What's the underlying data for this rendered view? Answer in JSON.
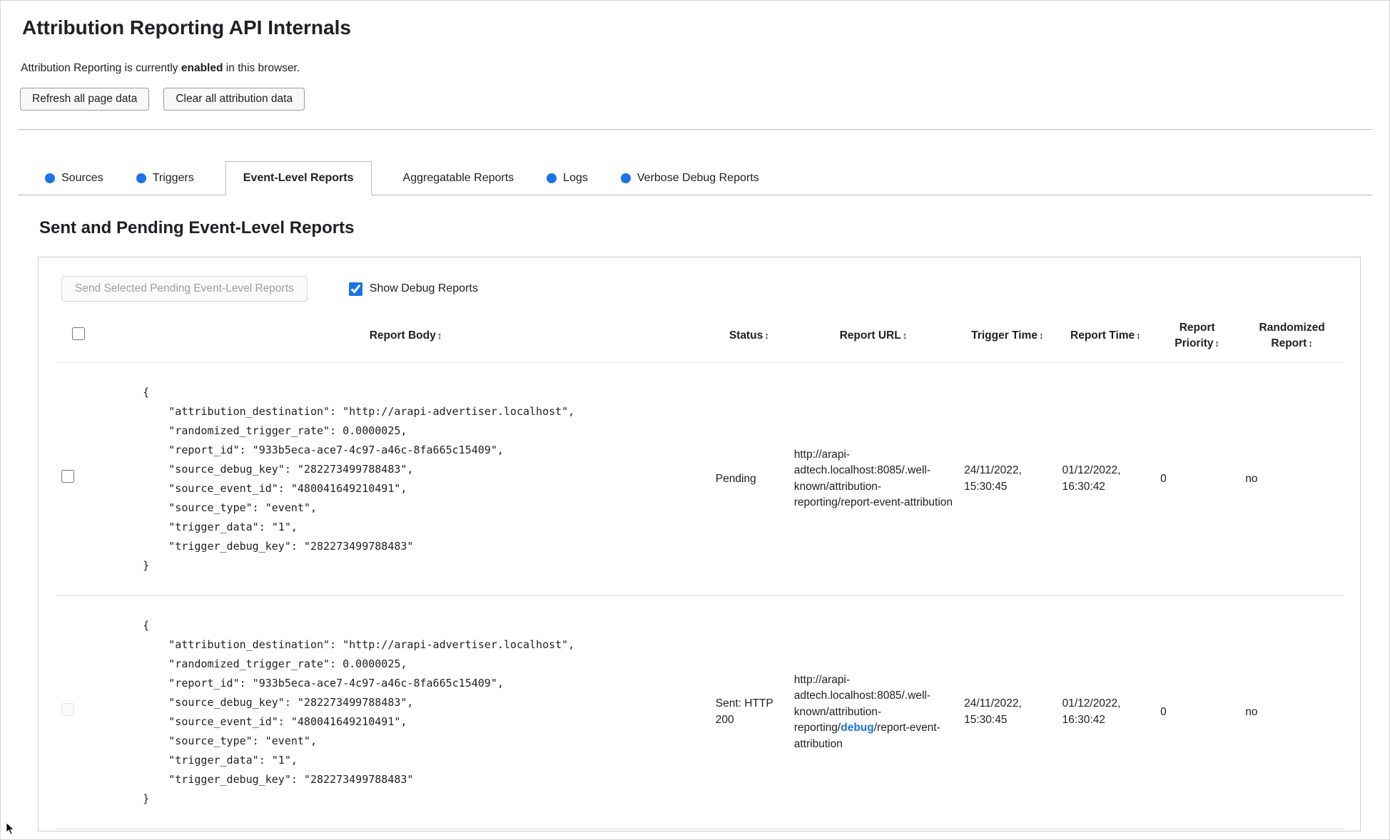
{
  "colors": {
    "accent": "#1a73e8"
  },
  "header": {
    "title": "Attribution Reporting API Internals",
    "status_prefix": "Attribution Reporting is currently ",
    "status_bold": "enabled",
    "status_suffix": " in this browser.",
    "refresh_button": "Refresh all page data",
    "clear_button": "Clear all attribution data"
  },
  "tabs": [
    {
      "label": "Sources"
    },
    {
      "label": "Triggers"
    },
    {
      "label": "Event-Level Reports"
    },
    {
      "label": "Aggregatable Reports"
    },
    {
      "label": "Logs"
    },
    {
      "label": "Verbose Debug Reports"
    }
  ],
  "section": {
    "heading": "Sent and Pending Event-Level Reports",
    "send_button": "Send Selected Pending Event-Level Reports",
    "show_debug_label": "Show Debug Reports"
  },
  "table": {
    "sort_icon": "↕",
    "headers": [
      "Report Body",
      "Status",
      "Report URL",
      "Trigger Time",
      "Report Time",
      "Report Priority",
      "Randomized Report"
    ],
    "rows": [
      {
        "report_body": "{\n    \"attribution_destination\": \"http://arapi-advertiser.localhost\",\n    \"randomized_trigger_rate\": 0.0000025,\n    \"report_id\": \"933b5eca-ace7-4c97-a46c-8fa665c15409\",\n    \"source_debug_key\": \"282273499788483\",\n    \"source_event_id\": \"480041649210491\",\n    \"source_type\": \"event\",\n    \"trigger_data\": \"1\",\n    \"trigger_debug_key\": \"282273499788483\"\n}",
        "status": "Pending",
        "url_before": "http://arapi-adtech.localhost:8085/.well-known/attribution-reporting/report-event-attribution",
        "url_debug": "",
        "url_after": "",
        "trigger_time": "24/11/2022, 15:30:45",
        "report_time": "01/12/2022, 16:30:42",
        "report_priority": "0",
        "randomized_report": "no"
      },
      {
        "report_body": "{\n    \"attribution_destination\": \"http://arapi-advertiser.localhost\",\n    \"randomized_trigger_rate\": 0.0000025,\n    \"report_id\": \"933b5eca-ace7-4c97-a46c-8fa665c15409\",\n    \"source_debug_key\": \"282273499788483\",\n    \"source_event_id\": \"480041649210491\",\n    \"source_type\": \"event\",\n    \"trigger_data\": \"1\",\n    \"trigger_debug_key\": \"282273499788483\"\n}",
        "status": "Sent: HTTP 200",
        "url_before": "http://arapi-adtech.localhost:8085/.well-known/attribution-reporting/",
        "url_debug": "debug",
        "url_after": "/report-event-attribution",
        "trigger_time": "24/11/2022, 15:30:45",
        "report_time": "01/12/2022, 16:30:42",
        "report_priority": "0",
        "randomized_report": "no"
      }
    ]
  }
}
